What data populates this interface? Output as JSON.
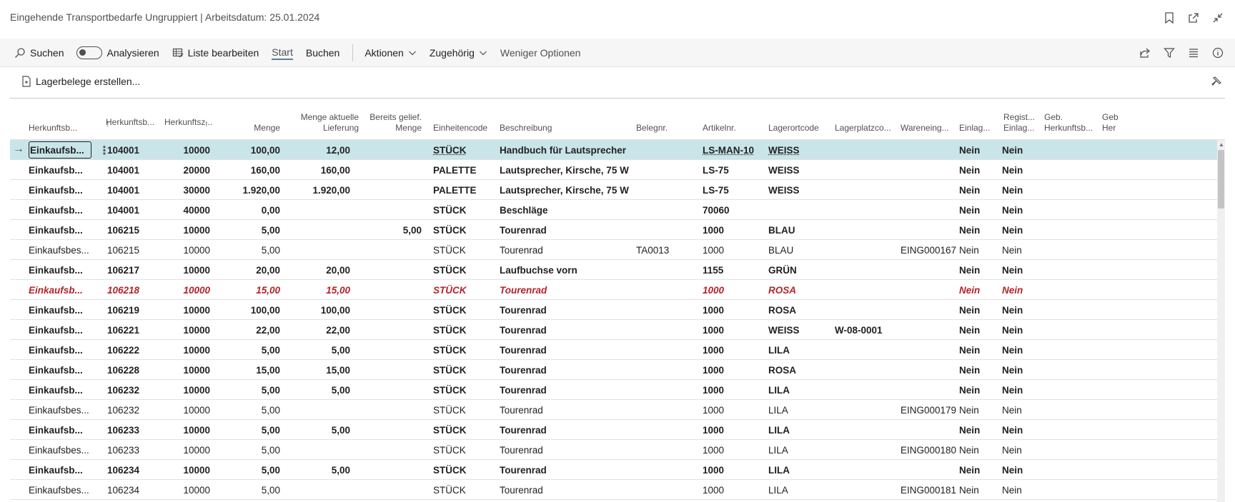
{
  "window": {
    "title": "Eingehende Transportbedarfe Ungruppiert | Arbeitsdatum: 25.01.2024"
  },
  "toolbar": {
    "search": "Suchen",
    "analyze": "Analysieren",
    "edit_list": "Liste bearbeiten",
    "start": "Start",
    "book": "Buchen",
    "actions": "Aktionen",
    "related": "Zugehörig",
    "fewer": "Weniger Optionen"
  },
  "subbar": {
    "create": "Lagerbelege erstellen..."
  },
  "columns": [
    {
      "label1": "",
      "label2": "Herkunftsb...",
      "sort": ""
    },
    {
      "label1": "Herkunftsb...",
      "label2": "",
      "sort": "↑"
    },
    {
      "label1": "Herkunftsz...",
      "label2": "",
      "sort": "↑"
    },
    {
      "label1": "",
      "label2": "Menge",
      "sort": ""
    },
    {
      "label1": "Menge aktuelle",
      "label2": "Lieferung",
      "sort": ""
    },
    {
      "label1": "Bereits gelief.",
      "label2": "Menge",
      "sort": ""
    },
    {
      "label1": "",
      "label2": "Einheitencode",
      "sort": ""
    },
    {
      "label1": "",
      "label2": "Beschreibung",
      "sort": ""
    },
    {
      "label1": "",
      "label2": "Belegnr.",
      "sort": ""
    },
    {
      "label1": "",
      "label2": "Artikelnr.",
      "sort": ""
    },
    {
      "label1": "",
      "label2": "Lagerortcode",
      "sort": ""
    },
    {
      "label1": "",
      "label2": "Lagerplatzco...",
      "sort": ""
    },
    {
      "label1": "",
      "label2": "Wareneing...",
      "sort": ""
    },
    {
      "label1": "",
      "label2": "Einlag...",
      "sort": ""
    },
    {
      "label1": "Regist...",
      "label2": "Einlag...",
      "sort": ""
    },
    {
      "label1": "Geb.",
      "label2": "Herkunftsb...",
      "sort": ""
    },
    {
      "label1": "Geb",
      "label2": "Her",
      "sort": ""
    }
  ],
  "rows": [
    {
      "style": "sel",
      "c": [
        "Einkaufsb...",
        "104001",
        "10000",
        "100,00",
        "12,00",
        "",
        "STÜCK",
        "Handbuch für Lautsprecher",
        "",
        "LS-MAN-10",
        "WEISS",
        "",
        "",
        "Nein",
        "Nein"
      ]
    },
    {
      "style": "bold",
      "c": [
        "Einkaufsb...",
        "104001",
        "20000",
        "160,00",
        "160,00",
        "",
        "PALETTE",
        "Lautsprecher, Kirsche, 75 W",
        "",
        "LS-75",
        "WEISS",
        "",
        "",
        "Nein",
        "Nein"
      ]
    },
    {
      "style": "bold",
      "c": [
        "Einkaufsb...",
        "104001",
        "30000",
        "1.920,00",
        "1.920,00",
        "",
        "PALETTE",
        "Lautsprecher, Kirsche, 75 W",
        "",
        "LS-75",
        "WEISS",
        "",
        "",
        "Nein",
        "Nein"
      ]
    },
    {
      "style": "bold",
      "c": [
        "Einkaufsb...",
        "104001",
        "40000",
        "0,00",
        "",
        "",
        "STÜCK",
        "Beschläge",
        "",
        "70060",
        "",
        "",
        "",
        "Nein",
        "Nein"
      ]
    },
    {
      "style": "bold",
      "c": [
        "Einkaufsb...",
        "106215",
        "10000",
        "5,00",
        "",
        "5,00",
        "STÜCK",
        "Tourenrad",
        "",
        "1000",
        "BLAU",
        "",
        "",
        "Nein",
        "Nein"
      ]
    },
    {
      "style": "normal",
      "c": [
        "Einkaufsbes...",
        "106215",
        "10000",
        "5,00",
        "",
        "",
        "STÜCK",
        "Tourenrad",
        "TA0013",
        "1000",
        "BLAU",
        "",
        "EING000167",
        "Nein",
        "Nein"
      ]
    },
    {
      "style": "bold",
      "c": [
        "Einkaufsb...",
        "106217",
        "10000",
        "20,00",
        "20,00",
        "",
        "STÜCK",
        "Laufbuchse vorn",
        "",
        "1155",
        "GRÜN",
        "",
        "",
        "Nein",
        "Nein"
      ]
    },
    {
      "style": "red",
      "c": [
        "Einkaufsb...",
        "106218",
        "10000",
        "15,00",
        "15,00",
        "",
        "STÜCK",
        "Tourenrad",
        "",
        "1000",
        "ROSA",
        "",
        "",
        "Nein",
        "Nein"
      ]
    },
    {
      "style": "bold",
      "c": [
        "Einkaufsb...",
        "106219",
        "10000",
        "100,00",
        "100,00",
        "",
        "STÜCK",
        "Tourenrad",
        "",
        "1000",
        "ROSA",
        "",
        "",
        "Nein",
        "Nein"
      ]
    },
    {
      "style": "bold",
      "c": [
        "Einkaufsb...",
        "106221",
        "10000",
        "22,00",
        "22,00",
        "",
        "STÜCK",
        "Tourenrad",
        "",
        "1000",
        "WEISS",
        "W-08-0001",
        "",
        "Nein",
        "Nein"
      ]
    },
    {
      "style": "bold",
      "c": [
        "Einkaufsb...",
        "106222",
        "10000",
        "5,00",
        "5,00",
        "",
        "STÜCK",
        "Tourenrad",
        "",
        "1000",
        "LILA",
        "",
        "",
        "Nein",
        "Nein"
      ]
    },
    {
      "style": "bold",
      "c": [
        "Einkaufsb...",
        "106228",
        "10000",
        "15,00",
        "15,00",
        "",
        "STÜCK",
        "Tourenrad",
        "",
        "1000",
        "ROSA",
        "",
        "",
        "Nein",
        "Nein"
      ]
    },
    {
      "style": "bold",
      "c": [
        "Einkaufsb...",
        "106232",
        "10000",
        "5,00",
        "5,00",
        "",
        "STÜCK",
        "Tourenrad",
        "",
        "1000",
        "LILA",
        "",
        "",
        "Nein",
        "Nein"
      ]
    },
    {
      "style": "normal",
      "c": [
        "Einkaufsbes...",
        "106232",
        "10000",
        "5,00",
        "",
        "",
        "STÜCK",
        "Tourenrad",
        "",
        "1000",
        "LILA",
        "",
        "EING000179",
        "Nein",
        "Nein"
      ]
    },
    {
      "style": "bold",
      "c": [
        "Einkaufsb...",
        "106233",
        "10000",
        "5,00",
        "5,00",
        "",
        "STÜCK",
        "Tourenrad",
        "",
        "1000",
        "LILA",
        "",
        "",
        "Nein",
        "Nein"
      ]
    },
    {
      "style": "normal",
      "c": [
        "Einkaufsbes...",
        "106233",
        "10000",
        "5,00",
        "",
        "",
        "STÜCK",
        "Tourenrad",
        "",
        "1000",
        "LILA",
        "",
        "EING000180",
        "Nein",
        "Nein"
      ]
    },
    {
      "style": "bold",
      "c": [
        "Einkaufsb...",
        "106234",
        "10000",
        "5,00",
        "5,00",
        "",
        "STÜCK",
        "Tourenrad",
        "",
        "1000",
        "LILA",
        "",
        "",
        "Nein",
        "Nein"
      ]
    },
    {
      "style": "normal",
      "c": [
        "Einkaufsbes...",
        "106234",
        "10000",
        "5,00",
        "",
        "",
        "STÜCK",
        "Tourenrad",
        "",
        "1000",
        "LILA",
        "",
        "EING000181",
        "Nein",
        "Nein"
      ]
    }
  ],
  "colors": {
    "selected_row": "#c9e5ea",
    "error_row": "#b4232a",
    "toolbar_bg": "#f6f6f6"
  }
}
